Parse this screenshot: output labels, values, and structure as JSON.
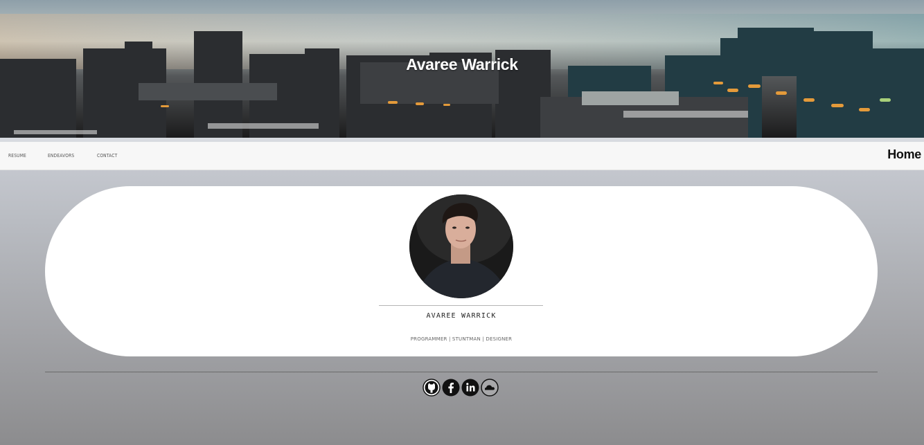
{
  "hero": {
    "title": "Avaree Warrick"
  },
  "nav": {
    "links": [
      {
        "label": "RESUME"
      },
      {
        "label": "ENDEAVORS"
      },
      {
        "label": "CONTACT"
      }
    ],
    "home_label": "Home"
  },
  "profile": {
    "name": "AVAREE WARRICK",
    "roles": "PROGRAMMER | STUNTMAN | DESIGNER"
  },
  "footer": {
    "socials": [
      {
        "icon": "github-icon"
      },
      {
        "icon": "facebook-icon"
      },
      {
        "icon": "linkedin-icon"
      },
      {
        "icon": "soundcloud-icon"
      }
    ],
    "note": ""
  }
}
